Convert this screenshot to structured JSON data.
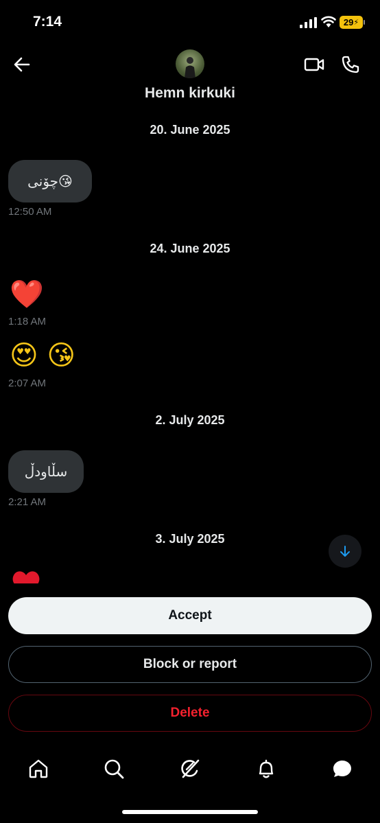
{
  "status_bar": {
    "time": "7:14",
    "battery": "29"
  },
  "header": {
    "name": "Hemn kirkuki"
  },
  "messages": {
    "d1": "20. June 2025",
    "m1": {
      "text": "چۆنی😘",
      "time": "12:50 AM"
    },
    "d2": "24. June 2025",
    "m2": {
      "emoji": "❤️",
      "time": "1:18 AM"
    },
    "m3": {
      "emoji": "😍 😘",
      "time": "2:07 AM"
    },
    "d3": "2. July 2025",
    "m4": {
      "text": "سڵاودڵ",
      "time": "2:21 AM"
    },
    "d4": "3. July 2025"
  },
  "actions": {
    "accept": "Accept",
    "block": "Block or report",
    "delete": "Delete"
  },
  "colors": {
    "accent": "#1d9bf0",
    "danger": "#f4212e",
    "bubble": "#2f3336"
  },
  "tabs": [
    "home-icon",
    "search-icon",
    "grok-icon",
    "bell-icon",
    "messages-icon"
  ]
}
